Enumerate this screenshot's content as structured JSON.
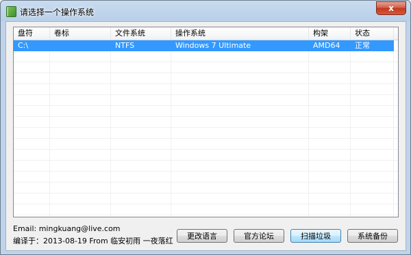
{
  "window": {
    "title": "请选择一个操作系统",
    "close_label": "x"
  },
  "columns": [
    "盘符",
    "卷标",
    "文件系统",
    "操作系统",
    "构架",
    "状态"
  ],
  "rows": [
    [
      "C:\\",
      "",
      "NTFS",
      "Windows 7 Ultimate",
      "AMD64",
      "正常"
    ]
  ],
  "footer": {
    "email": "Email: mingkuang@live.com",
    "compiled": "编译于：2013-08-19 From 临安初雨 一夜落红"
  },
  "buttons": {
    "language": "更改语言",
    "forum": "官方论坛",
    "scan": "扫描垃圾",
    "backup": "系统备份"
  },
  "colors": {
    "selection": "#3399ff"
  }
}
